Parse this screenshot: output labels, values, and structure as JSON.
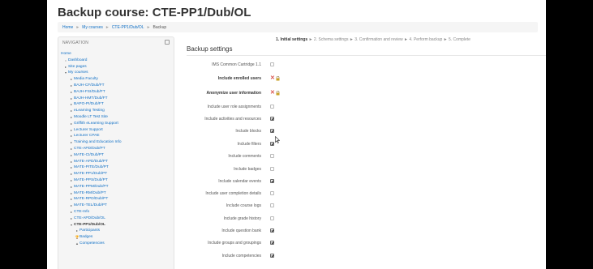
{
  "page": {
    "title": "Backup course: CTE-PP1/Dub/OL"
  },
  "breadcrumb": [
    {
      "label": "Home"
    },
    {
      "label": "My courses"
    },
    {
      "label": "CTE-PP1/Dub/OL"
    },
    {
      "label": "Backup"
    }
  ],
  "navigation": {
    "header": "NAVIGATION",
    "menu_icon": "block-menu-icon",
    "items": [
      {
        "label": "Home",
        "level": 0,
        "arrow": ""
      },
      {
        "label": "Dashboard",
        "level": 1,
        "arrow": "•"
      },
      {
        "label": "Site pages",
        "level": 1,
        "arrow": "▸"
      },
      {
        "label": "My courses",
        "level": 1,
        "arrow": "▾"
      },
      {
        "label": "Media Faculty",
        "level": 2,
        "arrow": "▸"
      },
      {
        "label": "BAJH-CF/Dub/FT",
        "level": 2,
        "arrow": "▸"
      },
      {
        "label": "BAJH-FSI/Dub/FT",
        "level": 2,
        "arrow": "▸"
      },
      {
        "label": "BAJH-HMT/Dub/FT",
        "level": 2,
        "arrow": "▸"
      },
      {
        "label": "BAPO-PI/Dub/FT",
        "level": 2,
        "arrow": "▸"
      },
      {
        "label": "eLearning Testing",
        "level": 2,
        "arrow": "▸"
      },
      {
        "label": "Moodle LT Test Site",
        "level": 2,
        "arrow": "▸"
      },
      {
        "label": "Griffith eLearning Support",
        "level": 2,
        "arrow": "▸"
      },
      {
        "label": "Lecturer Support",
        "level": 2,
        "arrow": "▸"
      },
      {
        "label": "Lecturer CPAE",
        "level": 2,
        "arrow": "▸"
      },
      {
        "label": "Training and Education Info",
        "level": 2,
        "arrow": "▸"
      },
      {
        "label": "CTE-APD/Dub/PT",
        "level": 2,
        "arrow": "▸"
      },
      {
        "label": "MATE-CI/Dub/PT",
        "level": 2,
        "arrow": "▸"
      },
      {
        "label": "MATE-APD/Dub/PT",
        "level": 2,
        "arrow": "▸"
      },
      {
        "label": "MATE-PITE/Dub/PT",
        "level": 2,
        "arrow": "▸"
      },
      {
        "label": "MATE-PP1/Dub/PT",
        "level": 2,
        "arrow": "▸"
      },
      {
        "label": "MATE-PPS/Dub/PT",
        "level": 2,
        "arrow": "▸"
      },
      {
        "label": "MATE-PPM/Dub/PT",
        "level": 2,
        "arrow": "▸"
      },
      {
        "label": "MATE-RM/Dub/PT",
        "level": 2,
        "arrow": "▸"
      },
      {
        "label": "MATE-RPD/Dub/PT",
        "level": 2,
        "arrow": "▸"
      },
      {
        "label": "MATE-TEL/Dub/PT",
        "level": 2,
        "arrow": "▸"
      },
      {
        "label": "CTE-Info",
        "level": 2,
        "arrow": "▸"
      },
      {
        "label": "CTE-APD/Dub/OL",
        "level": 2,
        "arrow": "▸"
      },
      {
        "label": "CTE-PP1/Dub/OL",
        "level": 2,
        "arrow": "▾",
        "bold": true
      },
      {
        "label": "Participants",
        "level": 3,
        "arrow": "▸"
      },
      {
        "label": "Badges",
        "level": 3,
        "arrow": "🏆"
      },
      {
        "label": "Competencies",
        "level": 3,
        "arrow": "▲"
      }
    ]
  },
  "stepper": {
    "steps": [
      {
        "label": "1. Initial settings",
        "current": true
      },
      {
        "label": "2. Schema settings",
        "current": false
      },
      {
        "label": "3. Confirmation and review",
        "current": false
      },
      {
        "label": "4. Perform backup",
        "current": false
      },
      {
        "label": "5. Complete",
        "current": false
      }
    ],
    "separator": "►"
  },
  "settings": {
    "heading": "Backup settings",
    "items": [
      {
        "label": "IMS Common Cartridge 1.1",
        "state": "unchecked",
        "bold": false
      },
      {
        "label": "Include enrolled users",
        "state": "locked",
        "bold": true
      },
      {
        "label": "Anonymize user information",
        "state": "locked",
        "bold": true
      },
      {
        "label": "Include user role assignments",
        "state": "unchecked",
        "bold": false
      },
      {
        "label": "Include activities and resources",
        "state": "checked",
        "bold": false
      },
      {
        "label": "Include blocks",
        "state": "checked",
        "bold": false
      },
      {
        "label": "Include filters",
        "state": "checked",
        "bold": false
      },
      {
        "label": "Include comments",
        "state": "unchecked",
        "bold": false
      },
      {
        "label": "Include badges",
        "state": "unchecked",
        "bold": false
      },
      {
        "label": "Include calendar events",
        "state": "checked",
        "bold": false
      },
      {
        "label": "Include user completion details",
        "state": "unchecked",
        "bold": false
      },
      {
        "label": "Include course logs",
        "state": "unchecked",
        "bold": false
      },
      {
        "label": "Include grade history",
        "state": "unchecked",
        "bold": false
      },
      {
        "label": "Include question bank",
        "state": "checked",
        "bold": false
      },
      {
        "label": "Include groups and groupings",
        "state": "checked",
        "bold": false
      },
      {
        "label": "Include competencies",
        "state": "checked",
        "bold": false
      }
    ]
  },
  "colors": {
    "link": "#0f6fc5",
    "locked": "#d9534f",
    "text": "#333333"
  }
}
